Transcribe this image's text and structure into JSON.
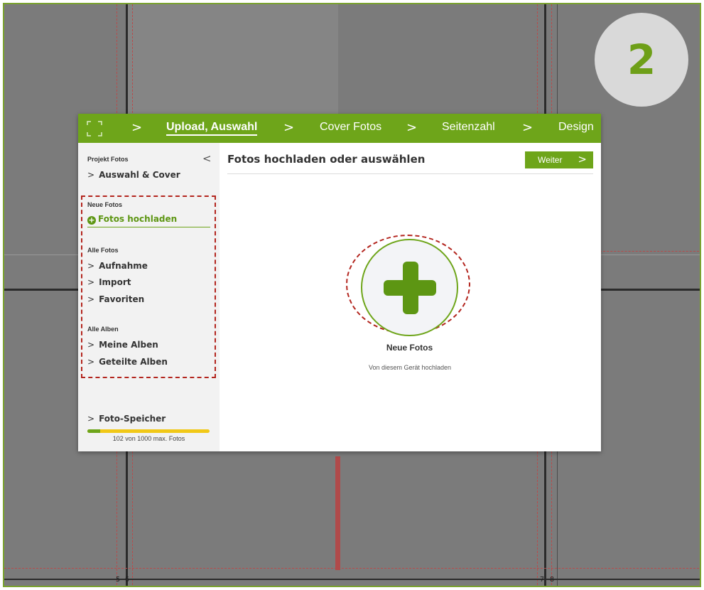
{
  "step": {
    "number": "2"
  },
  "page_numbers": [
    "5",
    "6",
    "7",
    "8"
  ],
  "topbar": {
    "steps": [
      "Upload, Auswahl",
      "Cover Fotos",
      "Seitenzahl",
      "Design"
    ],
    "active_index": 0
  },
  "sidebar": {
    "project_caption": "Projekt Fotos",
    "project_item": "Auswahl & Cover",
    "new_caption": "Neue Fotos",
    "upload_link": "Fotos hochladen",
    "all_photos_caption": "Alle Fotos",
    "all_photos_items": [
      "Aufnahme",
      "Import",
      "Favoriten"
    ],
    "all_albums_caption": "Alle Alben",
    "all_albums_items": [
      "Meine Alben",
      "Geteilte Alben"
    ],
    "storage_item": "Foto-Speicher",
    "storage_text": "102 von 1000 max. Fotos",
    "storage_used": 102,
    "storage_max": 1000
  },
  "main": {
    "title": "Fotos hochladen oder auswählen",
    "next_button": "Weiter",
    "upload_label": "Neue Fotos",
    "upload_sub": "Von diesem Gerät hochladen"
  },
  "colors": {
    "brand_green": "#6ea51a",
    "highlight_red": "#b3251e",
    "storage_yellow": "#f1c817"
  }
}
